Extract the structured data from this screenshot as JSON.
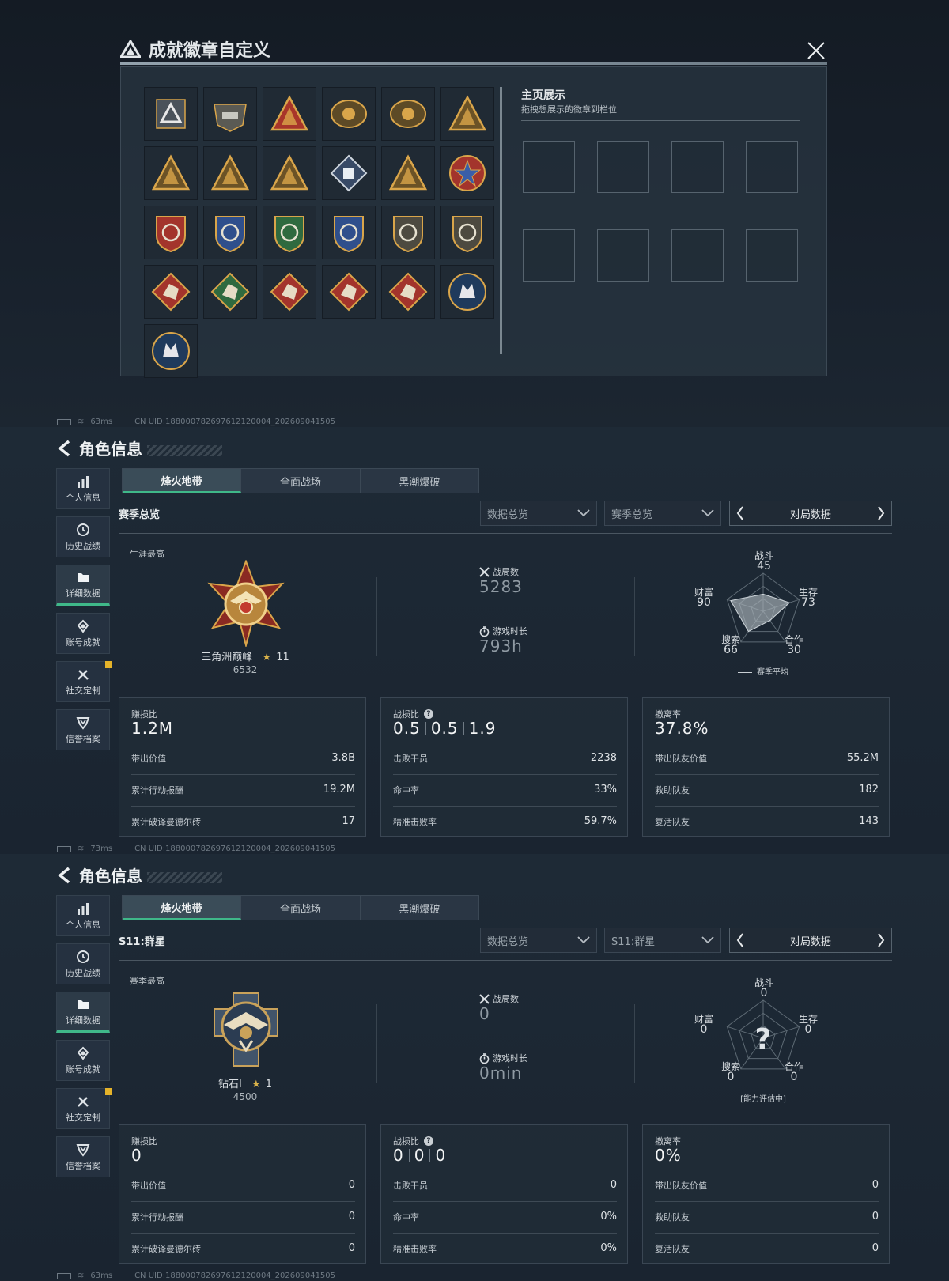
{
  "dialog": {
    "title": "成就徽章自定义",
    "showcase_title": "主页展示",
    "showcase_sub": "拖拽想展示的徽章到栏位",
    "badges": [
      {
        "icon": "triangle-delta-badge-icon"
      },
      {
        "icon": "helicopter-badge-icon"
      },
      {
        "icon": "numeral-two-badge-icon"
      },
      {
        "icon": "armored-vehicle-badge-icon"
      },
      {
        "icon": "shield-emblem-badge-icon"
      },
      {
        "icon": "winged-triangle-badge-icon"
      },
      {
        "icon": "soldier-triangle-badge-icon"
      },
      {
        "icon": "beast-triangle-badge-icon"
      },
      {
        "icon": "dolphin-triangle-badge-icon"
      },
      {
        "icon": "crystal-diamond-badge-icon"
      },
      {
        "icon": "rifleman-triangle-badge-icon"
      },
      {
        "icon": "star-roundel-badge-icon"
      },
      {
        "icon": "red-banner-badge-icon"
      },
      {
        "icon": "blue-crest-badge-icon"
      },
      {
        "icon": "green-rifle-shield-badge-icon"
      },
      {
        "icon": "blue-crossed-guns-badge-icon"
      },
      {
        "icon": "gold-eagle-shield-badge-icon"
      },
      {
        "icon": "gold-winged-shield-badge-icon"
      },
      {
        "icon": "wolf-diamond-badge-icon"
      },
      {
        "icon": "dragon-green-badge-icon"
      },
      {
        "icon": "dragon-red-badge-icon"
      },
      {
        "icon": "dragon-orange-badge-icon"
      },
      {
        "icon": "boot-diamond-badge-icon"
      },
      {
        "icon": "wolf-round-badge-icon"
      },
      {
        "icon": "wolf-circle-badge-icon"
      }
    ],
    "slots": 8,
    "colors": {
      "gold": "#d9a54a",
      "red": "#a3342c",
      "blue": "#2f4f8c",
      "green": "#2f6a3f"
    }
  },
  "status_bars": [
    {
      "ping": "63ms",
      "uid": "CN UID:18800078269761212000​4_202609041505"
    },
    {
      "ping": "73ms",
      "uid": "CN UID:18800078269761212000​4_202609041505"
    },
    {
      "ping": "63ms",
      "uid": "CN UID:18800078269761212000​4_202609041505"
    }
  ],
  "nav": {
    "title": "角色信息",
    "items": [
      {
        "label": "个人信息",
        "icon": "bar-chart-icon"
      },
      {
        "label": "历史战绩",
        "icon": "clock-icon"
      },
      {
        "label": "详细数据",
        "icon": "folder-icon"
      },
      {
        "label": "账号成就",
        "icon": "medal-icon"
      },
      {
        "label": "社交定制",
        "icon": "tools-icon"
      },
      {
        "label": "信誉档案",
        "icon": "shield-chevron-icon"
      }
    ]
  },
  "tabs": [
    "烽火地带",
    "全面战场",
    "黑潮爆破"
  ],
  "panels": [
    {
      "section": "赛季总览",
      "dropdown1": "数据总览",
      "dropdown2": "赛季总览",
      "pager": "对局数据",
      "caption": "生涯最高",
      "rank_name": "三角洲巅峰",
      "rank_stars": "11",
      "rank_score": "6532",
      "matches_label": "战局数",
      "matches": "5283",
      "time_label": "游戏时长",
      "time": "793h",
      "radar": {
        "battle": {
          "label": "战斗",
          "value": "45"
        },
        "survive": {
          "label": "生存",
          "value": "73"
        },
        "coop": {
          "label": "合作",
          "value": "30"
        },
        "search": {
          "label": "搜索",
          "value": "66"
        },
        "wealth": {
          "label": "财富",
          "value": "90"
        },
        "legend": "赛季平均",
        "levels": {
          "battle": 45,
          "survive": 73,
          "coop": 30,
          "search": 66,
          "wealth": 90
        }
      },
      "cards": [
        {
          "key": "赚损比",
          "value": "1.2M",
          "rows": [
            [
              "带出价值",
              "3.8B"
            ],
            [
              "累计行动报酬",
              "19.2M"
            ],
            [
              "累计破译曼德尔砖",
              "17"
            ]
          ]
        },
        {
          "key": "战损比",
          "trio": [
            "0.5",
            "0.5",
            "1.9"
          ],
          "rows": [
            [
              "击败干员",
              "2238"
            ],
            [
              "命中率",
              "33%"
            ],
            [
              "精准击败率",
              "59.7%"
            ]
          ]
        },
        {
          "key": "撤离率",
          "value": "37.8%",
          "rows": [
            [
              "带出队友价值",
              "55.2M"
            ],
            [
              "救助队友",
              "182"
            ],
            [
              "复活队友",
              "143"
            ]
          ]
        }
      ]
    },
    {
      "section": "S11:群星",
      "dropdown1": "数据总览",
      "dropdown2": "S11:群星",
      "pager": "对局数据",
      "caption": "赛季最高",
      "rank_name": "钻石I",
      "rank_stars": "1",
      "rank_score": "4500",
      "matches_label": "战局数",
      "matches": "0",
      "time_label": "游戏时长",
      "time": "0min",
      "radar": {
        "battle": {
          "label": "战斗",
          "value": "0"
        },
        "survive": {
          "label": "生存",
          "value": "0"
        },
        "coop": {
          "label": "合作",
          "value": "0"
        },
        "search": {
          "label": "搜索",
          "value": "0"
        },
        "wealth": {
          "label": "财富",
          "value": "0"
        },
        "legend": "[能力评估中]",
        "unknown": "?"
      },
      "cards": [
        {
          "key": "赚损比",
          "value": "0",
          "rows": [
            [
              "带出价值",
              "0"
            ],
            [
              "累计行动报酬",
              "0"
            ],
            [
              "累计破译曼德尔砖",
              "0"
            ]
          ]
        },
        {
          "key": "战损比",
          "trio": [
            "0",
            "0",
            "0"
          ],
          "rows": [
            [
              "击败干员",
              "0"
            ],
            [
              "命中率",
              "0%"
            ],
            [
              "精准击败率",
              "0%"
            ]
          ]
        },
        {
          "key": "撤离率",
          "value": "0%",
          "rows": [
            [
              "带出队友价值",
              "0"
            ],
            [
              "救助队友",
              "0"
            ],
            [
              "复活队友",
              "0"
            ]
          ]
        }
      ]
    }
  ]
}
